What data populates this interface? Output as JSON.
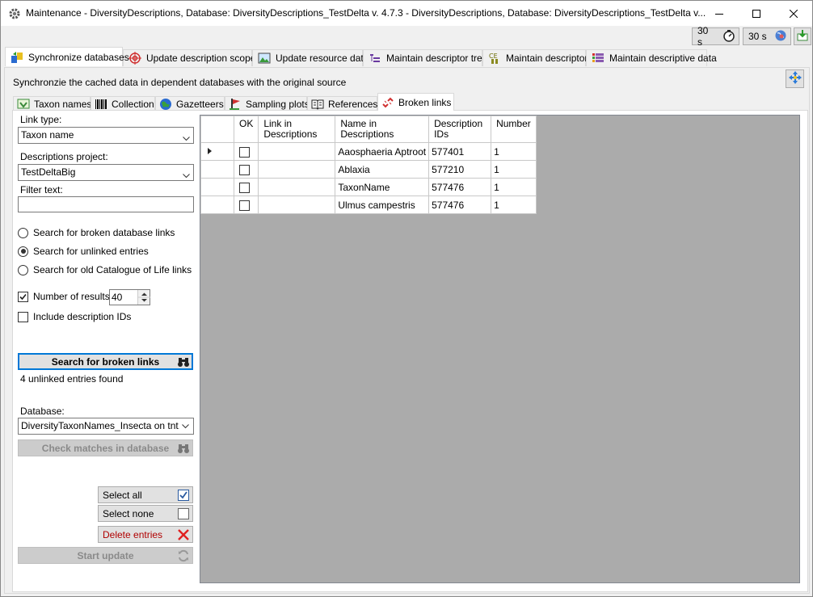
{
  "window": {
    "title": "Maintenance - DiversityDescriptions,  Database: DiversityDescriptions_TestDelta    v. 4.7.3 - DiversityDescriptions,  Database: DiversityDescriptions_TestDelta    v..."
  },
  "timers": [
    {
      "label": "30 s",
      "icon": "stopwatch-icon"
    },
    {
      "label": "30 s",
      "icon": "globe-icon"
    }
  ],
  "main_tabs": [
    {
      "label": "Synchronize databases",
      "icon": "sync-databases-icon",
      "active": true
    },
    {
      "label": "Update description scopes",
      "icon": "target-icon"
    },
    {
      "label": "Update resource data",
      "icon": "image-icon"
    },
    {
      "label": "Maintain descriptor trees",
      "icon": "tree-icon"
    },
    {
      "label": "Maintain descriptors",
      "icon": "descriptor-icon"
    },
    {
      "label": "Maintain descriptive data",
      "icon": "data-grid-icon"
    }
  ],
  "description_text": "Synchronzie the cached data in dependent databases with the original source",
  "sub_tabs": [
    {
      "label": "Taxon names",
      "icon": "taxon-icon"
    },
    {
      "label": "Collection",
      "icon": "barcode-icon"
    },
    {
      "label": "Gazetteers",
      "icon": "globe-icon"
    },
    {
      "label": "Sampling plots",
      "icon": "flag-icon"
    },
    {
      "label": "References",
      "icon": "book-icon"
    },
    {
      "label": "Broken links",
      "icon": "broken-link-icon",
      "active": true
    }
  ],
  "filters": {
    "link_type_label": "Link type:",
    "link_type_value": "Taxon name",
    "project_label": "Descriptions project:",
    "project_value": "TestDeltaBig",
    "filter_text_label": "Filter text:",
    "filter_text_value": ""
  },
  "search_options": [
    {
      "label": "Search for broken database links",
      "selected": false
    },
    {
      "label": "Search for unlinked entries",
      "selected": true
    },
    {
      "label": "Search for old Catalogue of Life links",
      "selected": false
    }
  ],
  "number_of_results": {
    "label": "Number of results:",
    "checked": true,
    "value": "40"
  },
  "include_ids": {
    "label": "Include description IDs",
    "checked": false
  },
  "search_button": "Search for broken links",
  "result_status": "4 unlinked entries found",
  "database": {
    "label": "Database:",
    "value": "DiversityTaxonNames_Insecta on tnt.diversityworkbench.de"
  },
  "check_matches_button": "Check matches in database",
  "select_all_button": "Select all",
  "select_none_button": "Select none",
  "delete_entries_button": "Delete entries",
  "start_update_button": "Start update",
  "grid": {
    "columns": [
      "OK",
      "Link in Descriptions",
      "Name in Descriptions",
      "Description IDs",
      "Number"
    ],
    "rows": [
      {
        "ok": false,
        "link": "",
        "name": "Aaosphaeria Aptroot",
        "ids": "577401",
        "number": "1",
        "current": true
      },
      {
        "ok": false,
        "link": "",
        "name": "Ablaxia",
        "ids": "577210",
        "number": "1"
      },
      {
        "ok": false,
        "link": "",
        "name": "TaxonName",
        "ids": "577476",
        "number": "1"
      },
      {
        "ok": false,
        "link": "",
        "name": "Ulmus campestris",
        "ids": "577476",
        "number": "1"
      }
    ]
  }
}
